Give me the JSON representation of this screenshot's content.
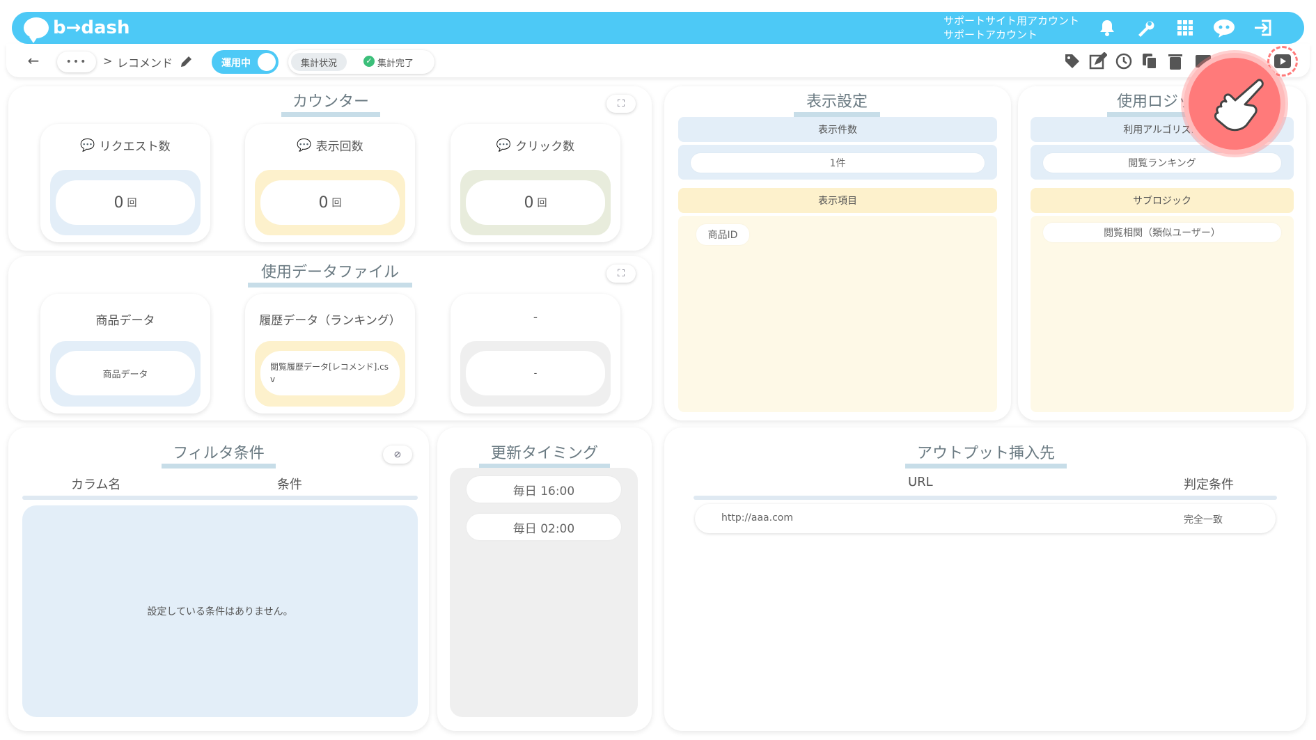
{
  "header": {
    "logo": "b→dash",
    "account_line1": "サポートサイト用アカウント",
    "account_line2": "サポートアカウント",
    "icons": [
      "bell-icon",
      "wrench-icon",
      "grid-icon",
      "chat-bot-icon",
      "logout-icon"
    ]
  },
  "subbar": {
    "back": "←",
    "more": "•••",
    "breadcrumb_sep": ">",
    "breadcrumb_current": "レコメンド",
    "toggle_label": "運用中",
    "status_tab": "集計状況",
    "status_done": "集計完了",
    "tools": [
      "tag-icon",
      "edit-icon",
      "history-icon",
      "copy-icon",
      "trash-icon",
      "play-icon"
    ]
  },
  "counter": {
    "title": "カウンター",
    "items": [
      {
        "label": "リクエスト数",
        "value": "0",
        "unit": "回",
        "color": "#e3eef8"
      },
      {
        "label": "表示回数",
        "value": "0",
        "unit": "回",
        "color": "#fdf1cc"
      },
      {
        "label": "クリック数",
        "value": "0",
        "unit": "回",
        "color": "#e8ecdc"
      }
    ]
  },
  "datafiles": {
    "title": "使用データファイル",
    "items": [
      {
        "label": "商品データ",
        "value": "商品データ"
      },
      {
        "label": "履歴データ（ランキング）",
        "value": "閲覧履歴データ[レコメンド].csv"
      },
      {
        "label": "-",
        "value": "-"
      }
    ]
  },
  "display": {
    "title": "表示設定",
    "count_header": "表示件数",
    "count_value": "1件",
    "items_header": "表示項目",
    "items": [
      "商品ID"
    ]
  },
  "logic": {
    "title": "使用ロジック",
    "algo_header": "利用アルゴリズム",
    "algo_value": "閲覧ランキング",
    "sub_header": "サブロジック",
    "sub_value": "閲覧相関（類似ユーザー）"
  },
  "filter": {
    "title": "フィルタ条件",
    "col1": "カラム名",
    "col2": "条件",
    "empty": "設定している条件はありません。"
  },
  "timing": {
    "title": "更新タイミング",
    "items": [
      "毎日 16:00",
      "毎日 02:00"
    ]
  },
  "output": {
    "title": "アウトプット挿入先",
    "col1": "URL",
    "col2": "判定条件",
    "rows": [
      {
        "url": "http://aaa.com",
        "cond": "完全一致"
      }
    ]
  }
}
